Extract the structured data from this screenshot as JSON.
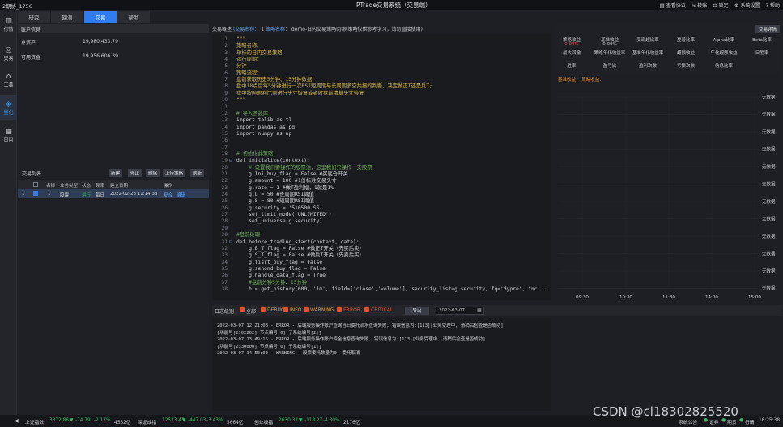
{
  "titlebar": {
    "user": "2期协_1756",
    "title": "PTrade交易系统（交易端）",
    "menu": [
      {
        "icon": "document-icon",
        "label": "查看协议"
      },
      {
        "icon": "refresh-icon",
        "label": "转账"
      },
      {
        "icon": "lock-icon",
        "label": "锁定"
      },
      {
        "icon": "gear-icon",
        "label": "系统设置"
      },
      {
        "icon": "help-icon",
        "label": "帮助"
      }
    ]
  },
  "leftnav": [
    {
      "icon": "chart-icon",
      "label": "行情",
      "active": false
    },
    {
      "icon": "loop-icon",
      "label": "交易",
      "active": false
    },
    {
      "icon": "tools-icon",
      "label": "工具",
      "active": false
    },
    {
      "icon": "robot-icon",
      "label": "量化",
      "active": true
    },
    {
      "icon": "calendar-icon",
      "label": "日内",
      "active": false
    }
  ],
  "tabs": [
    {
      "label": "研究",
      "active": false
    },
    {
      "label": "回测",
      "active": false
    },
    {
      "label": "交易",
      "active": true
    },
    {
      "label": "帮助",
      "active": false
    }
  ],
  "account": {
    "header": "账户信息",
    "rows": [
      {
        "label": "总资产",
        "value": "19,980,433.79"
      },
      {
        "label": "可用资金",
        "value": "19,956,606.39"
      }
    ]
  },
  "tradelist": {
    "title": "交易列表",
    "buttons": [
      "新建",
      "停止",
      "删除",
      "上传策略",
      "刷新"
    ],
    "columns": [
      "名称",
      "业务类型",
      "状态",
      "频率",
      "建立日期",
      "操作"
    ],
    "rows": [
      {
        "index": "1",
        "name": "1",
        "type": "股票",
        "status": "运行",
        "freq": "每日",
        "date": "2022-02-23 11:14:38",
        "op1": "复合",
        "op2": "编辑"
      }
    ]
  },
  "code": {
    "header_label": "交易概述",
    "trade_id_label": "(交易名称：",
    "trade_id": "1",
    "strategy_label": "策略名称：",
    "strategy_name": "demo-日内交易策略(示例策略仅供参考学习，请勿直接使用)",
    "lines": [
      {
        "n": "1",
        "fold": "",
        "cls": "c-y",
        "text": "\"\"\""
      },
      {
        "n": "2",
        "fold": "",
        "cls": "c-y",
        "text": "策略名称："
      },
      {
        "n": "3",
        "fold": "",
        "cls": "c-y",
        "text": "单标的日内交易策略"
      },
      {
        "n": "4",
        "fold": "",
        "cls": "c-y",
        "text": "运行周期："
      },
      {
        "n": "5",
        "fold": "",
        "cls": "c-y",
        "text": "分钟"
      },
      {
        "n": "6",
        "fold": "",
        "cls": "c-y",
        "text": "策略流程："
      },
      {
        "n": "7",
        "fold": "",
        "cls": "c-y",
        "text": "盘前获取历史5分钟、15分钟数据"
      },
      {
        "n": "8",
        "fold": "",
        "cls": "c-y",
        "text": "盘中18点后每5分钟进行一次RSI短周期与长周期多空共振的判断，决定做正T还是反T;"
      },
      {
        "n": "9",
        "fold": "",
        "cls": "c-y",
        "text": "盘中按照盈利比例进行头寸恢复或者收盘前清算头寸恢复"
      },
      {
        "n": "10",
        "fold": "",
        "cls": "c-y",
        "text": "\"\"\""
      },
      {
        "n": "11",
        "fold": "",
        "cls": "c-w",
        "text": ""
      },
      {
        "n": "12",
        "fold": "",
        "cls": "c-g",
        "text": "# 导入函数库"
      },
      {
        "n": "13",
        "fold": "",
        "cls": "c-w",
        "text": "import talib as tl"
      },
      {
        "n": "14",
        "fold": "",
        "cls": "c-w",
        "text": "import pandas as pd"
      },
      {
        "n": "15",
        "fold": "",
        "cls": "c-w",
        "text": "import numpy as np"
      },
      {
        "n": "16",
        "fold": "",
        "cls": "c-w",
        "text": ""
      },
      {
        "n": "17",
        "fold": "",
        "cls": "c-w",
        "text": ""
      },
      {
        "n": "18",
        "fold": "",
        "cls": "c-g",
        "text": "# 初始化此策略"
      },
      {
        "n": "19",
        "fold": "⊟",
        "cls": "c-w",
        "text": "def initialize(context):"
      },
      {
        "n": "20",
        "fold": "",
        "cls": "c-g",
        "text": "    # 设置我们要操作的股票池，这里我们只操作一支股票"
      },
      {
        "n": "21",
        "fold": "",
        "cls": "c-w",
        "text": "    g.Ini_buy_flag = False #买底仓开关"
      },
      {
        "n": "22",
        "fold": "",
        "cls": "c-w",
        "text": "    g.amount = 100 #1份标准交易头寸"
      },
      {
        "n": "23",
        "fold": "",
        "cls": "c-w",
        "text": "    g.rate = 1 #做T盈利幅，1就是1%"
      },
      {
        "n": "24",
        "fold": "",
        "cls": "c-w",
        "text": "    g.L = 50 #长周期RSI阈值"
      },
      {
        "n": "25",
        "fold": "",
        "cls": "c-w",
        "text": "    g.S = 80 #短周期RSI阈值"
      },
      {
        "n": "26",
        "fold": "",
        "cls": "c-w",
        "text": "    g.security = '510500.SS'"
      },
      {
        "n": "27",
        "fold": "",
        "cls": "c-w",
        "text": "    set_limit_mode('UNLIMITED')"
      },
      {
        "n": "28",
        "fold": "",
        "cls": "c-w",
        "text": "    set_universe(g.security)"
      },
      {
        "n": "29",
        "fold": "",
        "cls": "c-w",
        "text": ""
      },
      {
        "n": "30",
        "fold": "",
        "cls": "c-g",
        "text": "#盘前处理"
      },
      {
        "n": "31",
        "fold": "⊟",
        "cls": "c-w",
        "text": "def before_trading_start(context, data):"
      },
      {
        "n": "32",
        "fold": "",
        "cls": "c-w",
        "text": "    g.B_T_flag = False #做正T开关（先买后卖）"
      },
      {
        "n": "33",
        "fold": "",
        "cls": "c-w",
        "text": "    g.S_T_flag = False #做反T开关（先卖后买）"
      },
      {
        "n": "34",
        "fold": "",
        "cls": "c-w",
        "text": "    g.fisrt_buy_flag = False"
      },
      {
        "n": "35",
        "fold": "",
        "cls": "c-w",
        "text": "    g.senond_buy_flag = False"
      },
      {
        "n": "36",
        "fold": "",
        "cls": "c-w",
        "text": "    g.handle_data_flag = True"
      },
      {
        "n": "37",
        "fold": "",
        "cls": "c-g",
        "text": "    #盘前分钟5分钟、15分钟"
      },
      {
        "n": "38",
        "fold": "",
        "cls": "c-w",
        "text": "    h = get_history(600, '1m', field=['close','volume'], security_list=g.security, fq='dypre', inc..."
      }
    ]
  },
  "stats": {
    "detail_button": "交易详情",
    "cells": [
      {
        "label": "策略收益",
        "value": "0.04%",
        "red": true
      },
      {
        "label": "基准收益",
        "value": "0.00%",
        "red": false
      },
      {
        "label": "变现超比率",
        "value": "--",
        "red": false
      },
      {
        "label": "夏普比率",
        "value": "--",
        "red": false
      },
      {
        "label": "Alpha比率",
        "value": "--",
        "red": false
      },
      {
        "label": "Beta比率",
        "value": "--",
        "red": false
      },
      {
        "label": "最大回撤",
        "value": "--",
        "red": false
      },
      {
        "label": "策略年化收益率",
        "value": "--",
        "red": false
      },
      {
        "label": "基准年化收益率",
        "value": "--",
        "red": false
      },
      {
        "label": "超额收益",
        "value": "--",
        "red": false
      },
      {
        "label": "年化超额收益",
        "value": "--",
        "red": false
      },
      {
        "label": "日胜率",
        "value": "--",
        "red": false
      },
      {
        "label": "胜率",
        "value": "--",
        "red": false
      },
      {
        "label": "盈亏比",
        "value": "--",
        "red": false
      },
      {
        "label": "盈利次数",
        "value": "--",
        "red": false
      },
      {
        "label": "亏损次数",
        "value": "--",
        "red": false
      },
      {
        "label": "信息比率",
        "value": "--",
        "red": false
      },
      {
        "label": "",
        "value": "",
        "red": false
      }
    ],
    "chart_label": "基准收益：   策略收益：",
    "no_data": "无数据",
    "x_ticks": [
      "09:30",
      "10:30",
      "11:30",
      "14:00",
      "15:00"
    ]
  },
  "logbar": {
    "label": "日志级别",
    "levels": [
      {
        "name": "全部",
        "color": "#d0d2d7"
      },
      {
        "name": "DEBUG",
        "color": "#e0a030"
      },
      {
        "name": "INFO",
        "color": "#e0a030"
      },
      {
        "name": "WARNING",
        "color": "#e0a030"
      },
      {
        "name": "ERROR",
        "color": "#e0522d"
      },
      {
        "name": "CRITICAL",
        "color": "#e0522d"
      }
    ],
    "export": "导出",
    "date": "2022-03-07"
  },
  "logs": [
    "2022-03-07 12:21:08 - ERROR - 后端服务操作账户查询当日委托流水查询失败, 错误信息为:[113][业务受理中, 请稍后检查是否成功]",
    "[功能号[2102262] 节点编号[0] 子系统编号[2]]",
    "2022-03-07 13:49:15 - ERROR - 后端服务操作账户资金信息查询失败, 错误信息为:[113][业务受理中, 请稍后检查是否成功]",
    "[功能号[2330000] 节点编号[0] 子系统编号[1]]",
    "2022-03-07 14:50:00 - WARNING - 股票委托数量为0, 委托取消"
  ],
  "statusbar": [
    {
      "name": "上证指数",
      "value": "3372.86",
      "arrow": "▼",
      "chg": "-74.79",
      "pct": "-2.17%",
      "vol": "4582亿",
      "dir": "dn"
    },
    {
      "name": "深证成指",
      "value": "12573.43",
      "arrow": "▼",
      "chg": "-447.03",
      "pct": "-3.43%",
      "vol": "5664亿",
      "dir": "dn"
    },
    {
      "name": "创业板指",
      "value": "2630.37",
      "arrow": "▼",
      "chg": "-118.27",
      "pct": "-4.30%",
      "vol": "2176亿",
      "dir": "dn"
    }
  ],
  "statusbar_right": {
    "announce": "系统公告",
    "indicators": [
      "证券",
      "期货",
      "行情"
    ],
    "time": "16:25:38"
  },
  "watermark": "CSDN @cl18302825520"
}
